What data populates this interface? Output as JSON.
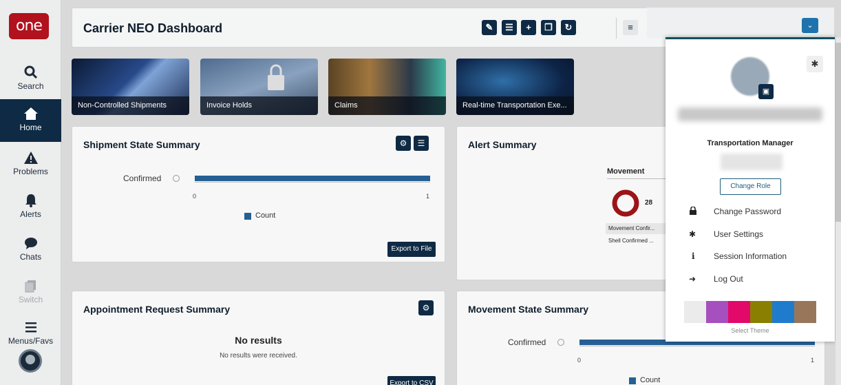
{
  "app": {
    "logo_text": "one"
  },
  "sidebar": {
    "items": [
      {
        "label": "Search",
        "icon": "search-icon"
      },
      {
        "label": "Home",
        "icon": "home-icon"
      },
      {
        "label": "Problems",
        "icon": "warning-icon"
      },
      {
        "label": "Alerts",
        "icon": "bell-icon"
      },
      {
        "label": "Chats",
        "icon": "chat-icon"
      },
      {
        "label": "Switch",
        "icon": "switch-icon"
      },
      {
        "label": "Menus/Favs",
        "icon": "menu-icon"
      }
    ]
  },
  "header": {
    "title": "Carrier NEO Dashboard",
    "toolbar_icons": [
      "edit-icon",
      "list-icon",
      "plus-icon",
      "copy-icon",
      "refresh-icon",
      "hamburger-icon"
    ]
  },
  "tiles": [
    {
      "label": "Non-Controlled Shipments"
    },
    {
      "label": "Invoice Holds"
    },
    {
      "label": "Claims"
    },
    {
      "label": "Real-time Transportation Exe..."
    }
  ],
  "shipment_state": {
    "title": "Shipment State Summary",
    "export_label": "Export to File"
  },
  "alert_summary": {
    "title": "Alert Summary",
    "movement_title": "Movement",
    "count": "28",
    "rows": [
      "Movement Confir...",
      "Shell Confirmed ..."
    ]
  },
  "appointment": {
    "title": "Appointment Request Summary",
    "empty_title": "No results",
    "empty_sub": "No results were received.",
    "export_label": "Export to CSV"
  },
  "movement_state": {
    "title": "Movement State Summary"
  },
  "chart_data": [
    {
      "type": "bar",
      "categories": [
        "Confirmed"
      ],
      "series": [
        {
          "name": "Count",
          "values": [
            1
          ]
        }
      ],
      "xlim": [
        0,
        1
      ],
      "x_ticks": [
        "0",
        "1"
      ],
      "legend": "bottom"
    },
    {
      "type": "bar",
      "categories": [
        "Confirmed"
      ],
      "series": [
        {
          "name": "Count",
          "values": [
            1
          ]
        }
      ],
      "xlim": [
        0,
        1
      ],
      "x_ticks": [
        "0",
        "1"
      ],
      "legend": "bottom"
    }
  ],
  "user_panel": {
    "role": "Transportation Manager",
    "change_role": "Change Role",
    "menu": [
      {
        "label": "Change Password",
        "icon": "lock-icon"
      },
      {
        "label": "User Settings",
        "icon": "gear-icon"
      },
      {
        "label": "Session Information",
        "icon": "info-icon"
      },
      {
        "label": "Log Out",
        "icon": "logout-icon"
      }
    ],
    "theme_label": "Select Theme",
    "themes": [
      "#ebebeb",
      "#a64fbf",
      "#e2096a",
      "#8a7f00",
      "#1f7ccc",
      "#98765a"
    ]
  }
}
